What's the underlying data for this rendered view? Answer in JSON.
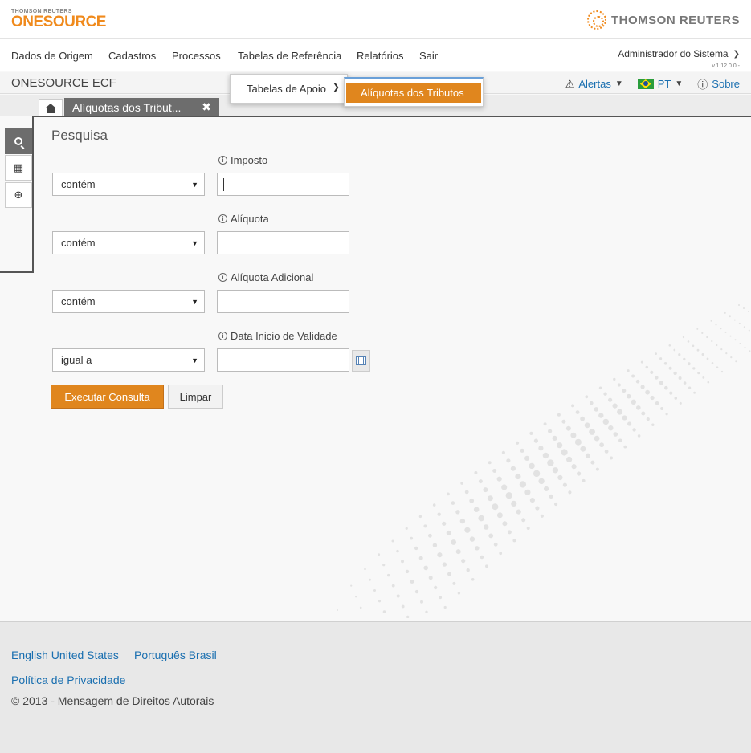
{
  "header": {
    "brand_small": "THOMSON REUTERS",
    "brand_name": "ONESOURCE",
    "tr_logo_text": "THOMSON REUTERS",
    "accent_color": "#e0861e"
  },
  "nav": {
    "items": [
      {
        "label": "Dados de Origem"
      },
      {
        "label": "Cadastros"
      },
      {
        "label": "Processos"
      },
      {
        "label": "Tabelas de Referência"
      },
      {
        "label": "Relatórios"
      },
      {
        "label": "Sair"
      }
    ],
    "user": "Administrador do Sistema",
    "version": "v.1.12.0.0.-"
  },
  "subheader": {
    "app_name": "ONESOURCE ECF",
    "alerts": "Alertas",
    "language": "PT",
    "about": "Sobre"
  },
  "tabs": {
    "active": "Alíquotas dos Tribut..."
  },
  "dropdown": {
    "level1": "Tabelas de Apoio",
    "level2": "Alíquotas dos Tributos"
  },
  "search": {
    "title": "Pesquisa",
    "fields": [
      {
        "label": "Imposto",
        "operator": "contém",
        "value": ""
      },
      {
        "label": "Alíquota",
        "operator": "contém",
        "value": ""
      },
      {
        "label": "Alíquota Adicional",
        "operator": "contém",
        "value": ""
      },
      {
        "label": "Data Inicio de Validade",
        "operator": "igual a",
        "value": ""
      }
    ],
    "execute_label": "Executar Consulta",
    "clear_label": "Limpar"
  },
  "footer": {
    "lang_en": "English United States",
    "lang_pt": "Português Brasil",
    "privacy": "Política de Privacidade",
    "copyright": "© 2013 - Mensagem de Direitos Autorais"
  }
}
